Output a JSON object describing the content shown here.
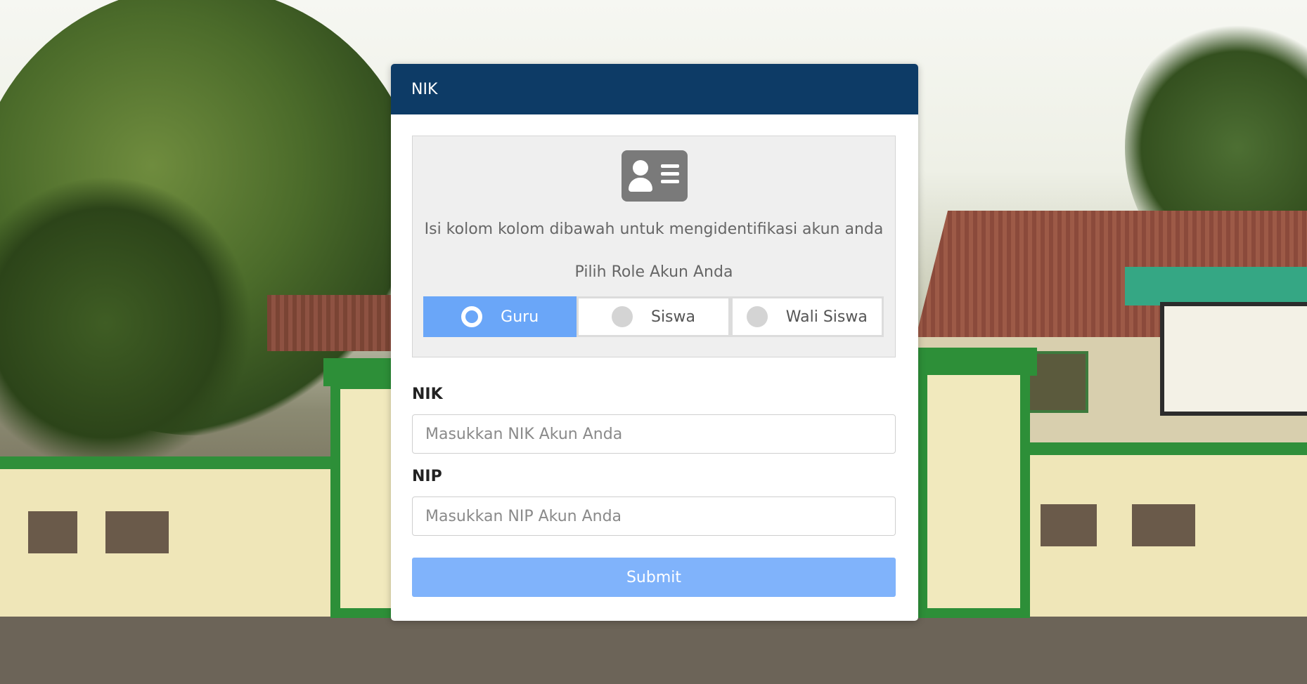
{
  "card": {
    "header_title": "NIK",
    "info_text": "Isi kolom kolom dibawah untuk mengidentifikasi akun anda",
    "role_label": "Pilih Role Akun Anda",
    "roles": [
      {
        "label": "Guru",
        "selected": true
      },
      {
        "label": "Siswa",
        "selected": false
      },
      {
        "label": "Wali Siswa",
        "selected": false
      }
    ],
    "nik_label": "NIK",
    "nik_placeholder": "Masukkan NIK Akun Anda",
    "nip_label": "NIP",
    "nip_placeholder": "Masukkan NIP Akun Anda",
    "submit_label": "Submit"
  },
  "colors": {
    "header_bg": "#0d3b66",
    "active_role": "#6aa6f8",
    "submit_bg": "#80b3fb"
  },
  "icons": {
    "id_card": "id-card-icon",
    "radio": "radio-icon"
  }
}
